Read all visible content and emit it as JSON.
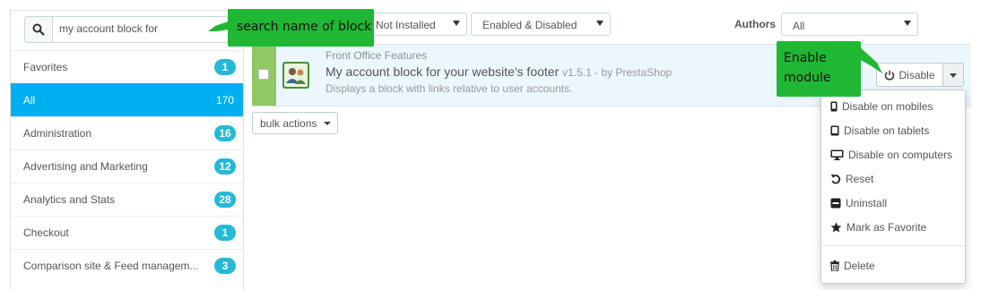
{
  "search": {
    "value": "my account block for"
  },
  "categories": [
    {
      "label": "Favorites",
      "count": "1"
    },
    {
      "label": "All",
      "count": "170",
      "active": true
    },
    {
      "label": "Administration",
      "count": "16"
    },
    {
      "label": "Advertising and Marketing",
      "count": "12"
    },
    {
      "label": "Analytics and Stats",
      "count": "28"
    },
    {
      "label": "Checkout",
      "count": "1"
    },
    {
      "label": "Comparison site & Feed managem...",
      "count": "3"
    }
  ],
  "filters": {
    "status": "Not Installed",
    "enabled": "Enabled & Disabled",
    "authors_label": "Authors",
    "authors_value": "All"
  },
  "module": {
    "category": "Front Office Features",
    "name": "My account block for your website's footer",
    "version": "v1.5.1 - by PrestaShop",
    "description": "Displays a block with links relative to user accounts.",
    "action_label": "Disable"
  },
  "bulk_actions": "bulk actions",
  "dropdown": [
    {
      "label": "Disable on mobiles",
      "icon": "mobile-icon"
    },
    {
      "label": "Disable on tablets",
      "icon": "tablet-icon"
    },
    {
      "label": "Disable on computers",
      "icon": "desktop-icon"
    },
    {
      "label": "Reset",
      "icon": "reset-icon"
    },
    {
      "label": "Uninstall",
      "icon": "minus-icon"
    },
    {
      "label": "Mark as Favorite",
      "icon": "star-icon"
    },
    {
      "label": "Delete",
      "icon": "trash-icon"
    }
  ],
  "callouts": {
    "search": "search name of block",
    "enable": "Enable\nmodule"
  },
  "colors": {
    "accent": "#00aff0",
    "badge": "#25b9d7",
    "callout": "#1fb733",
    "row_highlight": "#ebf7fd",
    "row_check": "#8fc864"
  }
}
